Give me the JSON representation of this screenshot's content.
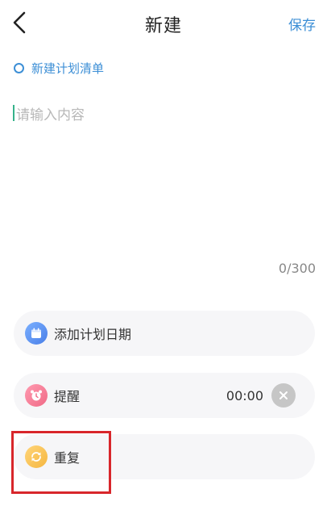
{
  "header": {
    "back_icon": "chevron-left-icon",
    "title": "新建",
    "save_label": "保存"
  },
  "plan_list": {
    "label": "新建计划清单",
    "icon": "radio-ring-icon"
  },
  "editor": {
    "placeholder": "请输入内容",
    "counter": "0/300"
  },
  "options": {
    "date": {
      "label": "添加计划日期",
      "icon": "calendar-icon"
    },
    "reminder": {
      "label": "提醒",
      "time": "00:00",
      "icon": "alarm-icon",
      "clear_icon": "close-icon"
    },
    "repeat": {
      "label": "重复",
      "icon": "repeat-icon"
    }
  },
  "colors": {
    "accent": "#3d8fd6",
    "highlight": "#d8262b"
  }
}
